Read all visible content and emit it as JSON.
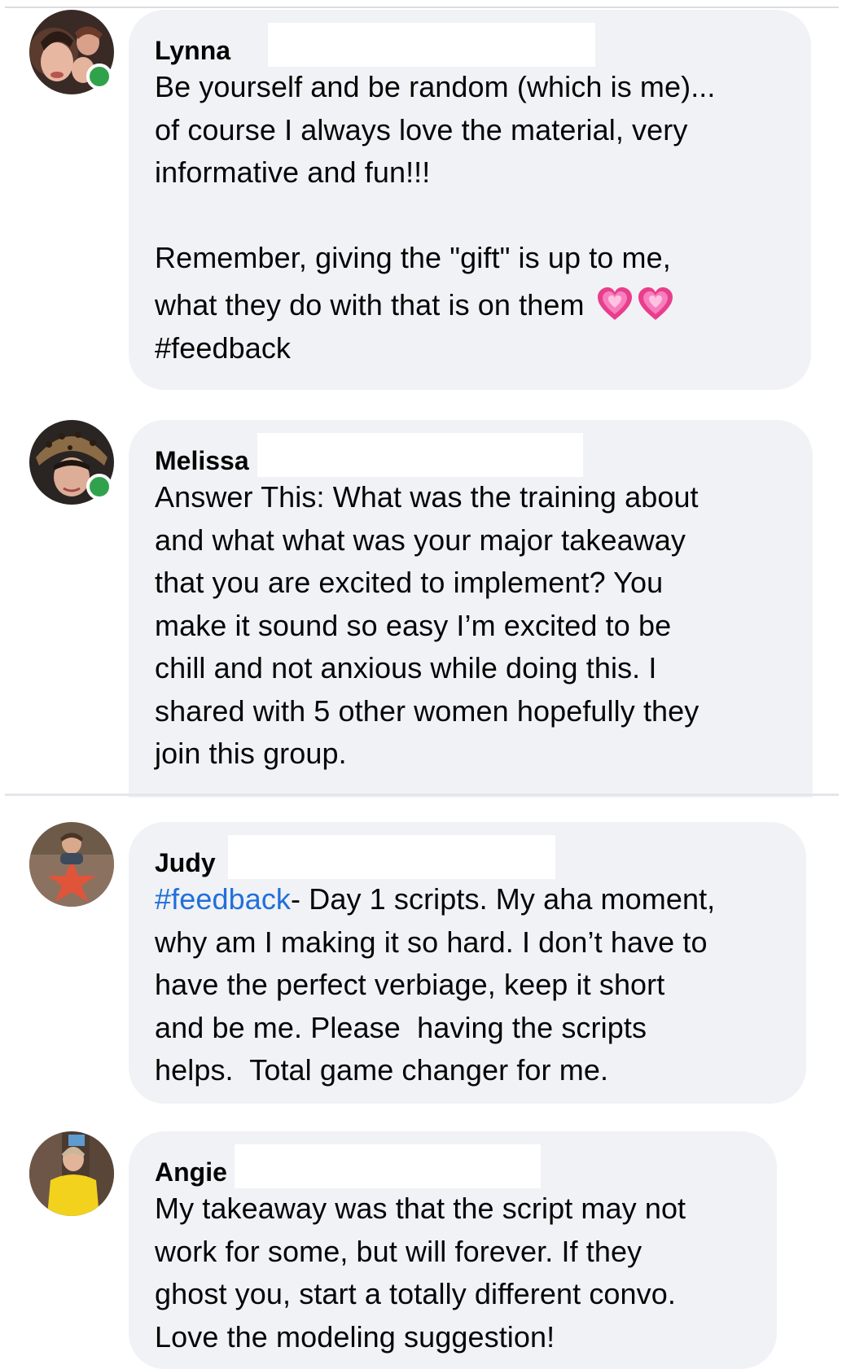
{
  "comments": [
    {
      "author": "Lynna",
      "online": true,
      "paragraph1": "Be yourself and be random (which is me)...\nof course I always love the material, very\ninformative and fun!!!",
      "paragraph2_line1": "Remember, giving the \"gift\" is up to me,",
      "paragraph2_line2": "what they do with that is on them",
      "emoji": "heart-emoji",
      "hashtag": "#feedback"
    },
    {
      "author": "Melissa",
      "online": true,
      "body": "Answer This: What was the training about\nand what what was your major takeaway\nthat you are excited to implement? You\nmake it sound so easy I’m excited to be\nchill and not anxious while doing this. I\nshared with 5 other women hopefully they\njoin this group."
    },
    {
      "author": "Judy",
      "online": false,
      "hashtag": "#feedback",
      "first_line_rest": "- Day 1 scripts. My aha moment,",
      "body": "why am I making it so hard. I don’t have to\nhave the perfect verbiage, keep it short\nand be me. Please  having the scripts\nhelps.  Total game changer for me."
    },
    {
      "author": "Angie",
      "online": false,
      "body": "My takeaway was that the script may not\nwork for some, but will forever. If they\nghost you, start a totally different convo.\nLove the modeling suggestion!"
    }
  ],
  "colors": {
    "bubble": "#f0f2f5",
    "hashtag_link": "#216fdb",
    "online": "#31a24c",
    "text": "#050505"
  }
}
